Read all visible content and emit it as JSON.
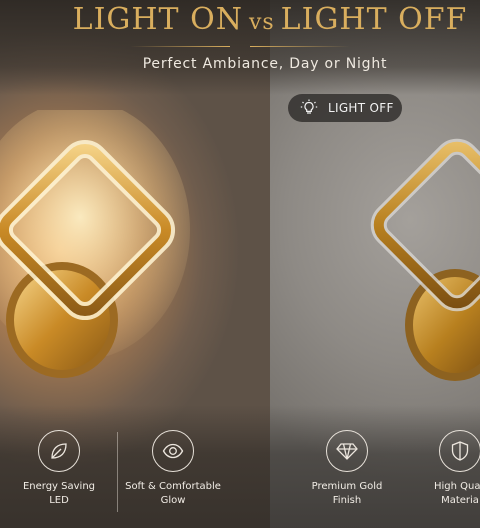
{
  "header": {
    "title_left": "LIGHT ON",
    "title_vs": "vs",
    "title_right": "LIGHT OFF",
    "subtitle": "Perfect Ambiance, Day or Night"
  },
  "badge": {
    "label": "LIGHT OFF",
    "icon": "bulb-icon"
  },
  "features": [
    {
      "label_line1": "Energy Saving",
      "label_line2": "LED",
      "icon": "leaf-icon"
    },
    {
      "label_line1": "Soft & Comfortable",
      "label_line2": "Glow",
      "icon": "eye-icon"
    },
    {
      "label_line1": "Premium Gold",
      "label_line2": "Finish",
      "icon": "diamond-icon"
    },
    {
      "label_line1": "High Quali",
      "label_line2": "Materia",
      "icon": "shield-icon"
    }
  ],
  "colors": {
    "gold_title": "#d9ae5e",
    "gold_metal": "#c8902a",
    "warm_glow": "#e8b47a",
    "gray_wall": "#8e8a85"
  }
}
